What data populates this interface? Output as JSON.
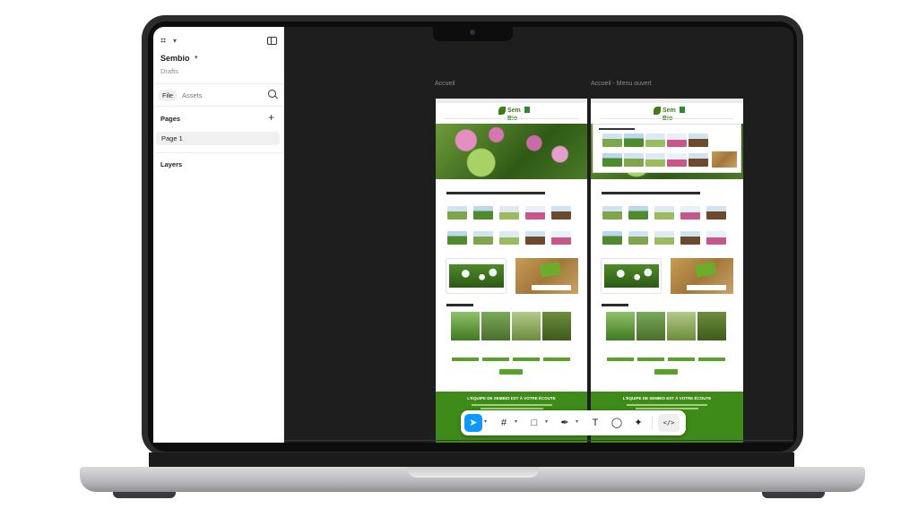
{
  "sidebar": {
    "project_name": "Sembio",
    "project_sub": "Drafts",
    "tabs": [
      {
        "label": "File"
      },
      {
        "label": "Assets"
      }
    ],
    "pages_label": "Pages",
    "pages": [
      {
        "label": "Page 1"
      }
    ],
    "layers_label": "Layers"
  },
  "canvas": {
    "frames": [
      {
        "label": "Accueil",
        "logo": "Sem Bio",
        "footer_title": "L'ÉQUIPE DE SEMBIO EST À VOTRE ÉCOUTE"
      },
      {
        "label": "Accueil - Menu ouvert",
        "logo": "Sem Bio",
        "footer_title": "L'ÉQUIPE DE SEMBIO EST À VOTRE ÉCOUTE"
      }
    ]
  },
  "toolbar": {
    "tools": [
      "move-tool",
      "frame-tool",
      "shape-tool",
      "pen-tool",
      "text-tool",
      "comment-tool",
      "actions-tool"
    ],
    "text_glyph": "T",
    "dev_label": "</>"
  },
  "colors": {
    "accent": "#0d99ff",
    "brand_green": "#3f8b19",
    "canvas_bg": "#1e1e1e"
  }
}
